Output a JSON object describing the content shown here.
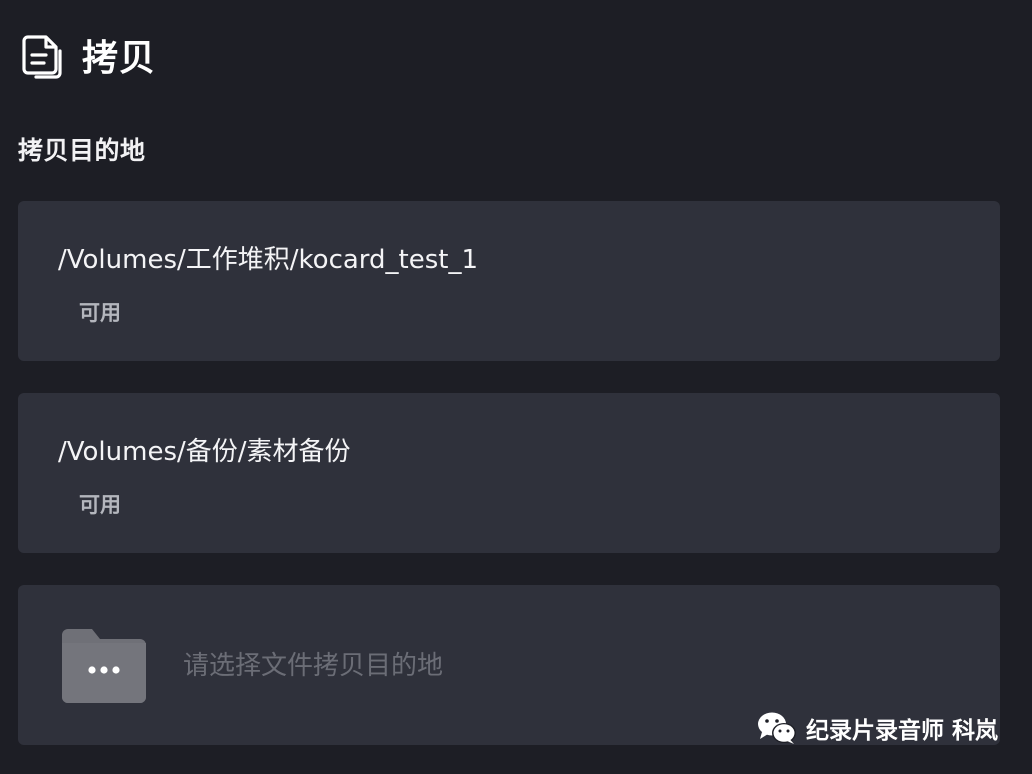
{
  "header": {
    "title": "拷贝",
    "icon": "document-icon"
  },
  "section": {
    "title": "拷贝目的地"
  },
  "destinations": [
    {
      "path": "/Volumes/工作堆积/kocard_test_1",
      "status": "可用"
    },
    {
      "path": "/Volumes/备份/素材备份",
      "status": "可用"
    }
  ],
  "chooser": {
    "icon": "folder-more-icon",
    "text": "请选择文件拷贝目的地"
  },
  "watermark": {
    "icon": "wechat-icon",
    "text": "纪录片录音师 科岚"
  },
  "colors": {
    "background": "#1d1e25",
    "card": "#2f313b",
    "status_text": "#b4b6bd",
    "placeholder_text": "#6b6d76",
    "folder": "#6f7077"
  }
}
